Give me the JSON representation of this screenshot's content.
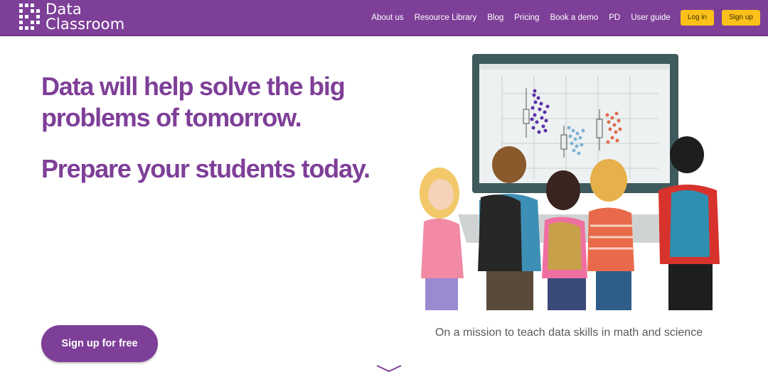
{
  "brand": {
    "name_line1": "Data",
    "name_line2": "Classroom",
    "color": "#7e3f98",
    "accent": "#fbc11a"
  },
  "nav": {
    "links": [
      "About us",
      "Resource Library",
      "Blog",
      "Pricing",
      "Book a demo",
      "PD",
      "User guide"
    ],
    "login_label": "Log in",
    "signup_label": "Sign up"
  },
  "hero": {
    "title": "Data will help solve the big problems of tomorrow.",
    "subtitle": "Prepare your students today.",
    "cta_label": "Sign up for free",
    "tagline": "On a mission to teach data skills in math and science"
  },
  "icons": {
    "logo": "data-classroom-logo-icon",
    "scroll": "chevron-down-icon"
  }
}
